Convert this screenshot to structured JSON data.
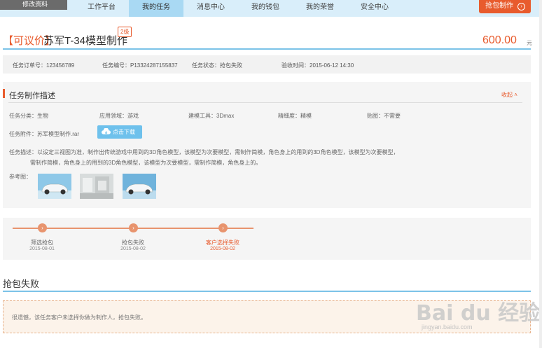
{
  "header": {
    "profile_label": "修改资料",
    "nav": [
      {
        "label": "工作平台"
      },
      {
        "label": "我的任务"
      },
      {
        "label": "消息中心"
      },
      {
        "label": "我的钱包"
      },
      {
        "label": "我的荣誉"
      },
      {
        "label": "安全中心"
      }
    ],
    "active_nav": "我的任务",
    "grab_button": "抢包制作"
  },
  "task": {
    "tag": "【可议价】",
    "title": "苏军T-34模型制作",
    "level": "2级",
    "price": "600.00",
    "price_unit": "元",
    "order_no": "任务订单号：123456789",
    "task_no": "任务编号：P13324287155837",
    "status": "任务状态：抢包失败",
    "accept_time": "验收时间：2015-06-12  14:30"
  },
  "desc": {
    "heading": "任务制作描述",
    "collapse": "收起",
    "category": "任务分类：生物",
    "field_area": "应用领域：游戏",
    "tool": "建模工具：3Dmax",
    "precision": "精细度：精模",
    "texture": "贴图：不需要",
    "attachment": "任务附件：苏军模型制作.rar",
    "download": "点击下载",
    "description_label": "任务描述：",
    "description_line1": "以设定三视图为准，制作出传统游戏中用到的3D角色模型，该模型为次要模型，需制作简模，角色身上的用到的3D角色模型，该模型为次要模型，",
    "description_line2": "需制作简模，角色身上的用到的3D角色模型，该模型为次要模型，需制作简模，角色身上的。",
    "ref_label": "参考图："
  },
  "timeline": [
    {
      "label": "筛选抢包",
      "date": "2015-08-01"
    },
    {
      "label": "抢包失败",
      "date": "2015-08-02"
    },
    {
      "label": "客户选择失败",
      "date": "2015-08-02"
    }
  ],
  "result": {
    "title": "抢包失败",
    "message": "很遗憾，该任务客户未选择你做为制作人，抢包失败。"
  },
  "watermark": {
    "main": "Bai du 经验",
    "sub": "jingyan.baidu.com"
  },
  "colors": {
    "accent": "#e85b2d",
    "nav_bg": "#d9eefa",
    "nav_active": "#a9d9f3",
    "rule": "#7cc3e8"
  }
}
